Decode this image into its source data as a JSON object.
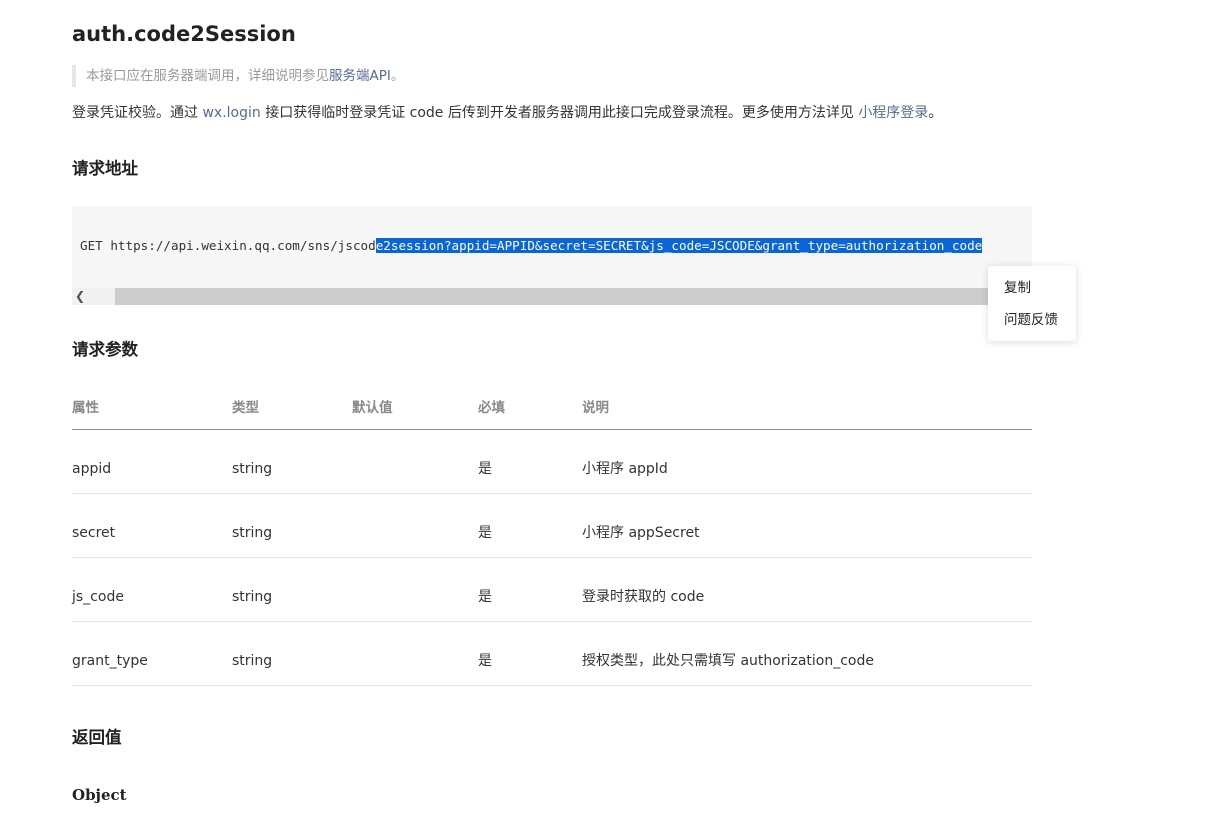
{
  "title": "auth.code2Session",
  "note": {
    "prefix": "本接口应在服务器端调用，详细说明参见",
    "link": "服务端API",
    "suffix": "。"
  },
  "description": {
    "part1": "登录凭证校验。通过 ",
    "link1": "wx.login",
    "part2": " 接口获得临时登录凭证 code 后传到开发者服务器调用此接口完成登录流程。更多使用方法详见 ",
    "link2": "小程序登录",
    "part3": "。"
  },
  "sections": {
    "request_url": "请求地址",
    "request_params": "请求参数",
    "return_value": "返回值"
  },
  "code": {
    "normal": "GET https://api.weixin.qq.com/sns/jscod",
    "selected": "e2session?appid=APPID&secret=SECRET&js_code=JSCODE&grant_type=authorization_code"
  },
  "context_menu": {
    "copy": "复制",
    "feedback": "问题反馈"
  },
  "table": {
    "headers": [
      "属性",
      "类型",
      "默认值",
      "必填",
      "说明"
    ],
    "rows": [
      [
        "appid",
        "string",
        "",
        "是",
        "小程序 appId"
      ],
      [
        "secret",
        "string",
        "",
        "是",
        "小程序 appSecret"
      ],
      [
        "js_code",
        "string",
        "",
        "是",
        "登录时获取的 code"
      ],
      [
        "grant_type",
        "string",
        "",
        "是",
        "授权类型，此处只需填写 authorization_code"
      ]
    ]
  },
  "return_type": "Object",
  "colors": {
    "link": "#576b95",
    "selection": "#0a66d6",
    "code_bg": "#f7f7f8"
  }
}
